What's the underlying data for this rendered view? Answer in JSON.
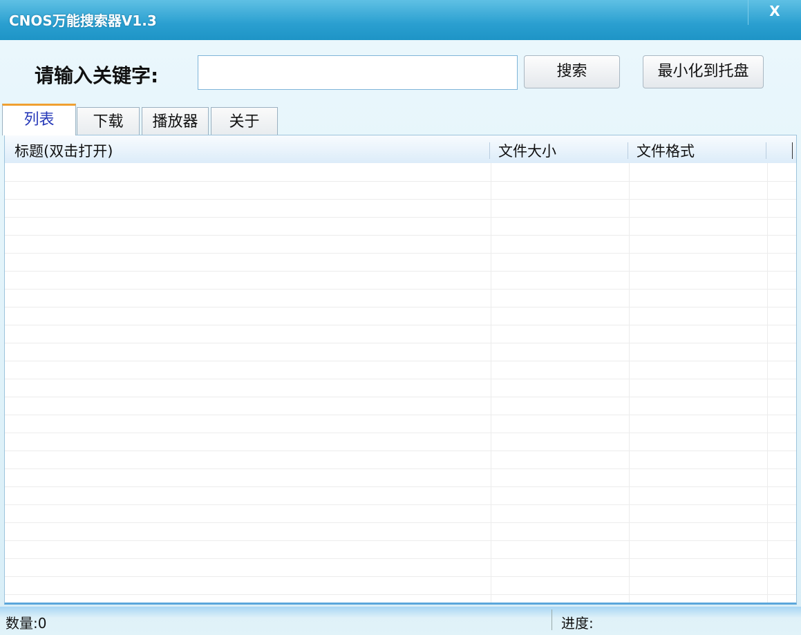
{
  "window": {
    "title": "CNOS万能搜索器V1.3",
    "close_label": "X"
  },
  "search": {
    "label": "请输入关键字:",
    "value": "",
    "search_button": "搜索",
    "tray_button": "最小化到托盘"
  },
  "tabs": [
    {
      "label": "列表",
      "active": true
    },
    {
      "label": "下载"
    },
    {
      "label": "播放器"
    },
    {
      "label": "关于"
    }
  ],
  "table": {
    "columns": [
      "标题(双击打开)",
      "文件大小",
      "文件格式"
    ],
    "rows": []
  },
  "status": {
    "count": "数量:0",
    "progress": "进度:"
  }
}
